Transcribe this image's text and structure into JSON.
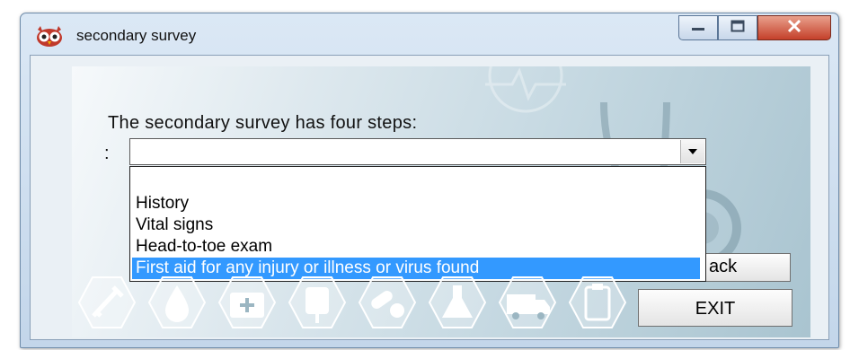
{
  "window": {
    "title": "secondary survey",
    "app_icon": "owl-icon",
    "controls": {
      "minimize": "minimize-icon",
      "maximize": "maximize-icon",
      "close": "close-icon"
    }
  },
  "form": {
    "prompt": "The secondary survey has four steps:",
    "colon": ":",
    "combo": {
      "value": "",
      "arrow": "chevron-down-icon"
    },
    "options": [
      "History",
      "Vital signs",
      "Head-to-toe exam",
      "First aid for any injury or illness or virus found"
    ],
    "selected_index": 3
  },
  "buttons": {
    "back": "ack",
    "exit": "EXIT"
  },
  "decor_icons": [
    "syringe-icon",
    "drop-icon",
    "first-aid-kit-icon",
    "iv-bag-icon",
    "pills-icon",
    "flask-icon",
    "ambulance-icon",
    "clipboard-icon"
  ],
  "colors": {
    "selection": "#3399ff",
    "close_button": "#c4402a",
    "window_frame": "#c3d6ea"
  }
}
